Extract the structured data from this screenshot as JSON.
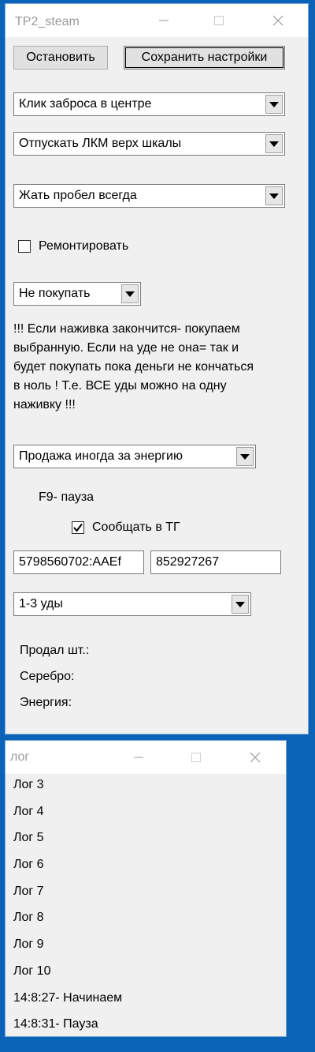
{
  "main_window": {
    "title": "TP2_steam",
    "stop_label": "Остановить",
    "save_label": "Сохранить настройки",
    "cast_mode": "Клик заброса в центре",
    "lmb_release": "Отпускать ЛКМ верх шкалы",
    "space_mode": "Жать пробел всегда",
    "repair_label": "Ремонтировать",
    "repair_checked": false,
    "buy_mode": "Не покупать",
    "bait_note": "!!! Если наживка закончится- покупаем выбранную. Если на уде не она= так и будет покупать пока деньги не кончаться в ноль ! Т.е. ВСЕ уды можно на одну наживку !!!",
    "sell_mode": "Продажа иногда за энергию",
    "pause_hint": "F9- пауза",
    "tg_label": "Сообщать в ТГ",
    "tg_checked": true,
    "tg_token": "5798560702:AAEf",
    "tg_chat_id": "852927267",
    "rods": "1-3 уды",
    "sold_label": "Продал шт.:",
    "silver_label": "Серебро:",
    "energy_label": "Энергия:"
  },
  "log_window": {
    "title": "лог",
    "entries": [
      "Лог 3",
      "Лог 4",
      "Лог 5",
      "Лог 6",
      "Лог 7",
      "Лог 8",
      "Лог 9",
      "Лог 10",
      "14:8:27- Начинаем",
      "14:8:31- Пауза"
    ]
  },
  "colors": {
    "desktop": "#0b63b8",
    "window_bg": "#f0f0f0",
    "title_text": "#9a9a9a"
  }
}
